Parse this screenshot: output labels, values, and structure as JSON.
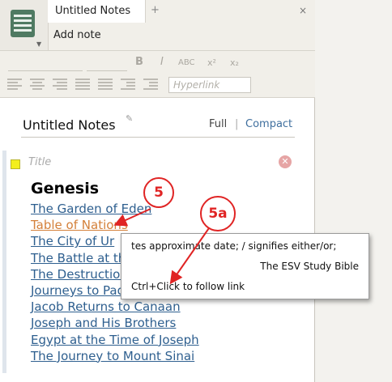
{
  "tab": {
    "title": "Untitled Notes",
    "add": "+",
    "close": "×"
  },
  "topbar": {
    "add_note": "Add note"
  },
  "toolbar": {
    "bold": "B",
    "italic": "I",
    "smallcaps": "ABC",
    "superscript": "x²",
    "subscript": "x₂",
    "hyperlink_placeholder": "Hyperlink"
  },
  "note": {
    "title": "Untitled Notes",
    "view_full": "Full",
    "view_sep": "|",
    "view_compact": "Compact",
    "title_placeholder": "Title",
    "heading": "Genesis",
    "links": [
      "The Garden of Eden",
      "Table of Nations",
      "The City of Ur",
      "The Battle at the Valley",
      "The Destruction of Sodom",
      "Journeys to Paddan-aram",
      "Jacob Returns to Canaan",
      "Joseph and His Brothers",
      "Egypt at the Time of Joseph",
      "The Journey to Mount Sinai"
    ]
  },
  "tooltip": {
    "line1": "tes approximate date; / signifies either/or;",
    "line2": "The ESV Study Bible",
    "line3": "Ctrl+Click to follow link"
  },
  "callouts": {
    "first": "5",
    "second": "5a"
  },
  "colors": {
    "link": "#2e5f8f",
    "active_link": "#d4803a",
    "callout": "#e02424"
  }
}
